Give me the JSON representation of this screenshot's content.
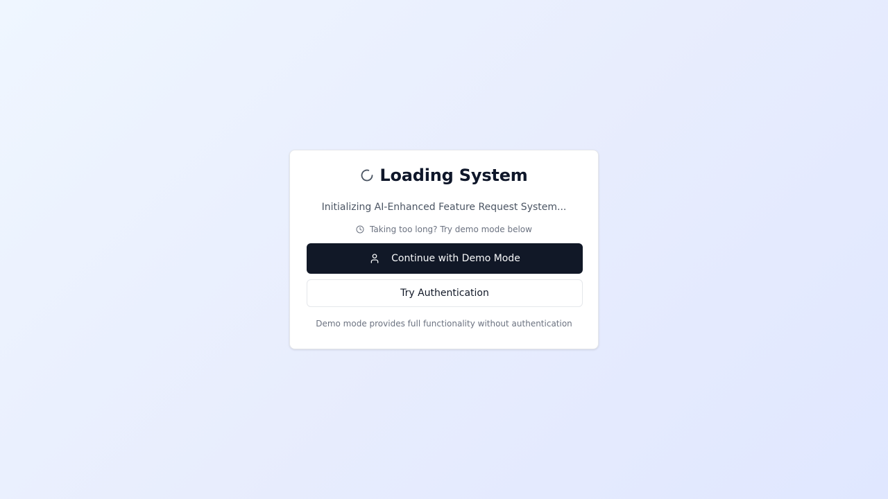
{
  "card": {
    "title": "Loading System",
    "title_icon": "spinner-icon",
    "subtitle": "Initializing AI-Enhanced Feature Request System...",
    "hint_icon": "clock-icon",
    "hint": "Taking too long? Try demo mode below",
    "primary_button": {
      "label": "Continue with Demo Mode",
      "icon": "user-icon"
    },
    "secondary_button": {
      "label": "Try Authentication"
    },
    "footnote": "Demo mode provides full functionality without authentication"
  },
  "colors": {
    "primary_button_bg": "#111827",
    "title_text": "#0f172a",
    "muted_text": "#6b7280",
    "background_from": "#eff6ff",
    "background_to": "#e0e7ff"
  }
}
